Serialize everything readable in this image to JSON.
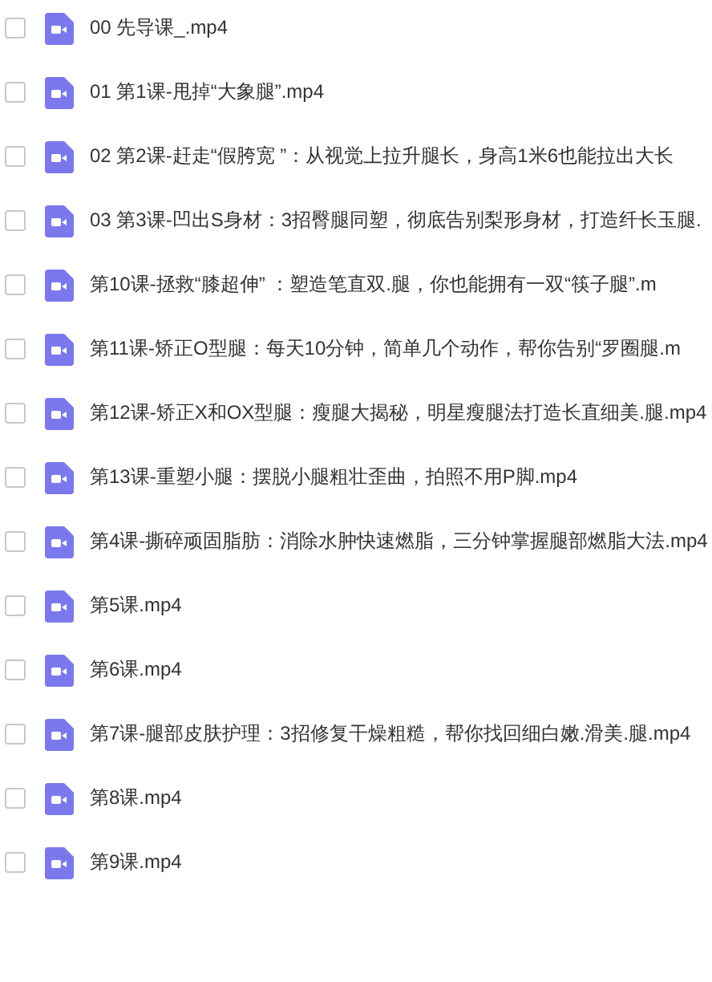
{
  "files": [
    {
      "name": "00 先导课_.mp4",
      "checked": false
    },
    {
      "name": "01 第1课-甩掉“大象腿”.mp4",
      "checked": false
    },
    {
      "name": "02 第2课-赶走“假胯宽 ”：从视觉上拉升腿长，身高1米6也能拉出大长",
      "checked": false
    },
    {
      "name": "03 第3课-凹出S身材：3招臀腿同塑，彻底告别梨形身材，打造纤长玉腿.",
      "checked": false
    },
    {
      "name": "第10课-拯救“膝超伸” ：塑造笔直双.腿，你也能拥有一双“筷子腿”.m",
      "checked": false
    },
    {
      "name": "第11课-矫正O型腿：每天10分钟，简单几个动作，帮你告别“罗圈腿.m",
      "checked": false
    },
    {
      "name": "第12课-矫正X和OX型腿：瘦腿大揭秘，明星瘦腿法打造长直细美.腿.mp4",
      "checked": false
    },
    {
      "name": "第13课-重塑小腿：摆脱小腿粗壮歪曲，拍照不用P脚.mp4",
      "checked": false
    },
    {
      "name": "第4课-撕碎顽固脂肪：消除水肿快速燃脂，三分钟掌握腿部燃脂大法.mp4",
      "checked": false
    },
    {
      "name": "第5课.mp4",
      "checked": false
    },
    {
      "name": "第6课.mp4",
      "checked": false
    },
    {
      "name": "第7课-腿部皮肤护理：3招修复干燥粗糙，帮你找回细白嫩.滑美.腿.mp4",
      "checked": false
    },
    {
      "name": "第8课.mp4",
      "checked": false
    },
    {
      "name": "第9课.mp4",
      "checked": false
    }
  ]
}
